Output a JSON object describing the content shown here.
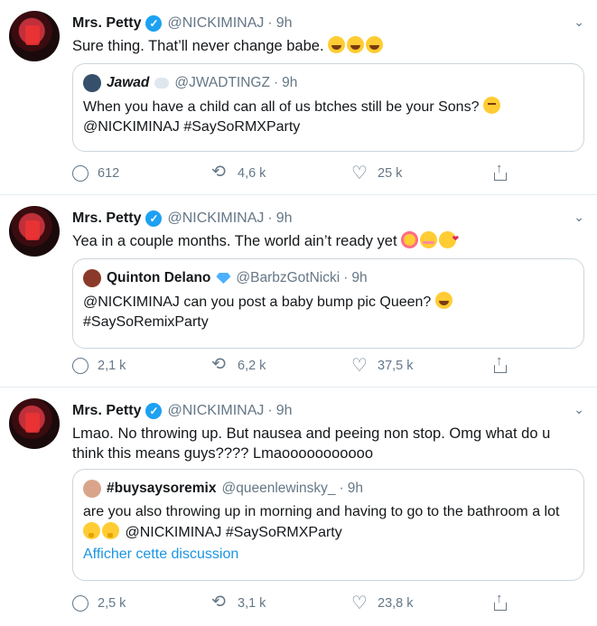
{
  "tweets": [
    {
      "name": "Mrs. Petty",
      "handle": "@NICKIMINAJ",
      "time": "9h",
      "text": "Sure thing. That’ll never change babe.",
      "quote": {
        "name": "Jawad",
        "handle": "@JWADTINGZ",
        "time": "9h",
        "text": "When you have a child can all of us btches still be your Sons?",
        "text2": "@NICKIMINAJ #SaySoRMXParty"
      },
      "actions": {
        "replies": "612",
        "retweets": "4,6 k",
        "likes": "25 k"
      }
    },
    {
      "name": "Mrs. Petty",
      "handle": "@NICKIMINAJ",
      "time": "9h",
      "text": "Yea in a couple months. The world ain’t ready yet",
      "quote": {
        "name": "Quinton Delano",
        "handle": "@BarbzGotNicki",
        "time": "9h",
        "text": "@NICKIMINAJ can you post a baby bump pic Queen?",
        "text2": "#SaySoRemixParty"
      },
      "actions": {
        "replies": "2,1 k",
        "retweets": "6,2 k",
        "likes": "37,5 k"
      }
    },
    {
      "name": "Mrs. Petty",
      "handle": "@NICKIMINAJ",
      "time": "9h",
      "text": "Lmao. No throwing up. But nausea and peeing non stop. Omg what do u think this means guys????  Lmaooooooooooo",
      "quote": {
        "name": "#buysaysoremix",
        "handle": "@queenlewinsky_",
        "time": "9h",
        "text": "are you also throwing up in morning and having to go to the bathroom a lot",
        "text2": "@NICKIMINAJ #SaySoRMXParty",
        "link": "Afficher cette discussion"
      },
      "actions": {
        "replies": "2,5 k",
        "retweets": "3,1 k",
        "likes": "23,8 k"
      }
    }
  ],
  "colors": {
    "accent": "#1da1f2",
    "muted": "#657786",
    "link": "#1b95e0",
    "border": "#ccd6dd"
  }
}
